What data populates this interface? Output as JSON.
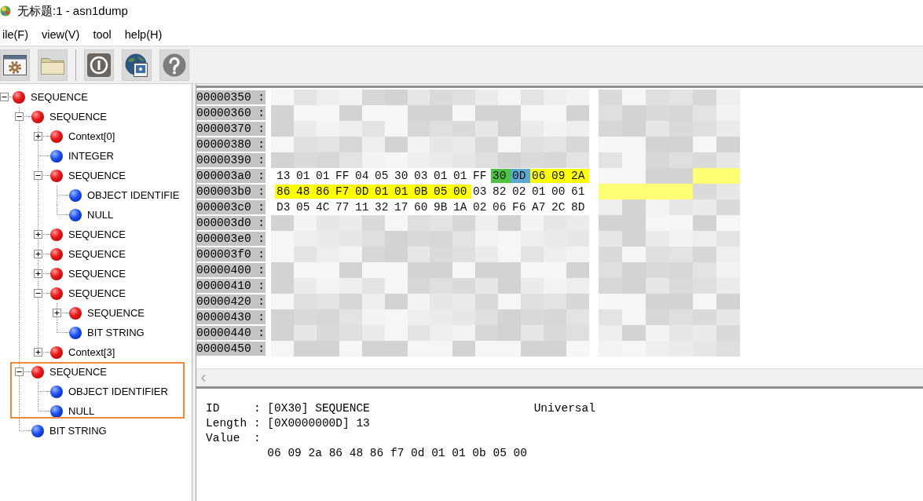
{
  "window": {
    "title": "无标题:1 - asn1dump"
  },
  "menu": [
    "ile(F)",
    "view(V)",
    "tool",
    "help(H)"
  ],
  "toolbar": [
    {
      "kind": "window-gear"
    },
    {
      "kind": "folder"
    },
    {
      "kind": "separator"
    },
    {
      "kind": "ring-bar"
    },
    {
      "kind": "globe-picture"
    },
    {
      "kind": "help"
    }
  ],
  "tree": [
    {
      "label": "SEQUENCE",
      "kind": "constructed",
      "expanded": true,
      "annotated": false,
      "children": [
        {
          "label": "SEQUENCE",
          "kind": "constructed",
          "expanded": true,
          "annotated": false,
          "children": [
            {
              "label": "Context[0]",
              "kind": "constructed",
              "expanded": false,
              "annotated": false
            },
            {
              "label": "INTEGER",
              "kind": "primitive",
              "annotated": false
            },
            {
              "label": "SEQUENCE",
              "kind": "constructed",
              "expanded": true,
              "annotated": false,
              "children": [
                {
                  "label": "OBJECT IDENTIFIE",
                  "kind": "primitive",
                  "annotated": false
                },
                {
                  "label": "NULL",
                  "kind": "primitive",
                  "annotated": false
                }
              ]
            },
            {
              "label": "SEQUENCE",
              "kind": "constructed",
              "expanded": false,
              "annotated": false
            },
            {
              "label": "SEQUENCE",
              "kind": "constructed",
              "expanded": false,
              "annotated": false
            },
            {
              "label": "SEQUENCE",
              "kind": "constructed",
              "expanded": false,
              "annotated": false
            },
            {
              "label": "SEQUENCE",
              "kind": "constructed",
              "expanded": true,
              "annotated": false,
              "children": [
                {
                  "label": "SEQUENCE",
                  "kind": "constructed",
                  "expanded": false,
                  "annotated": false
                },
                {
                  "label": "BIT STRING",
                  "kind": "primitive",
                  "annotated": false
                }
              ]
            },
            {
              "label": "Context[3]",
              "kind": "constructed",
              "expanded": false,
              "annotated": false
            }
          ]
        },
        {
          "label": "SEQUENCE",
          "kind": "constructed",
          "expanded": true,
          "annotated": true,
          "children": [
            {
              "label": "OBJECT IDENTIFIER",
              "kind": "primitive",
              "annotated": false
            },
            {
              "label": "NULL",
              "kind": "primitive",
              "annotated": false
            }
          ]
        },
        {
          "label": "BIT STRING",
          "kind": "primitive",
          "annotated": false
        }
      ]
    }
  ],
  "hex_view": {
    "rows": [
      {
        "offset": "00000350 :",
        "pixelated": true
      },
      {
        "offset": "00000360 :",
        "pixelated": true
      },
      {
        "offset": "00000370 :",
        "pixelated": true
      },
      {
        "offset": "00000380 :",
        "pixelated": true
      },
      {
        "offset": "00000390 :",
        "pixelated": true
      },
      {
        "offset": "000003a0 :",
        "pixelated": false,
        "bytes": [
          {
            "text": "13"
          },
          {
            "text": "01"
          },
          {
            "text": "01"
          },
          {
            "text": "FF"
          },
          {
            "text": "04"
          },
          {
            "text": "05"
          },
          {
            "text": "30"
          },
          {
            "text": "03"
          },
          {
            "text": "01"
          },
          {
            "text": "01"
          },
          {
            "text": "FF"
          },
          {
            "text": "30",
            "color": "#4dc441"
          },
          {
            "text": "0D",
            "color": "#5ba9d3"
          },
          {
            "text": "06",
            "color": "#ffff00"
          },
          {
            "text": "09",
            "color": "#ffff00"
          },
          {
            "text": "2A",
            "color": "#ffff00"
          }
        ]
      },
      {
        "offset": "000003b0 :",
        "pixelated": false,
        "bytes": [
          {
            "text": "86",
            "color": "#ffff00"
          },
          {
            "text": "48",
            "color": "#ffff00"
          },
          {
            "text": "86",
            "color": "#ffff00"
          },
          {
            "text": "F7",
            "color": "#ffff00"
          },
          {
            "text": "0D",
            "color": "#ffff00"
          },
          {
            "text": "01",
            "color": "#ffff00"
          },
          {
            "text": "01",
            "color": "#ffff00"
          },
          {
            "text": "0B",
            "color": "#ffff00"
          },
          {
            "text": "05",
            "color": "#ffff00"
          },
          {
            "text": "00",
            "color": "#ffff00"
          },
          {
            "text": "03"
          },
          {
            "text": "82"
          },
          {
            "text": "02"
          },
          {
            "text": "01"
          },
          {
            "text": "00"
          },
          {
            "text": "61"
          }
        ]
      },
      {
        "offset": "000003c0 :",
        "pixelated": false,
        "bytes": [
          {
            "text": "D3"
          },
          {
            "text": "05"
          },
          {
            "text": "4C"
          },
          {
            "text": "77"
          },
          {
            "text": "11"
          },
          {
            "text": "32"
          },
          {
            "text": "17"
          },
          {
            "text": "60"
          },
          {
            "text": "9B"
          },
          {
            "text": "1A"
          },
          {
            "text": "02"
          },
          {
            "text": "06"
          },
          {
            "text": "F6"
          },
          {
            "text": "A7"
          },
          {
            "text": "2C"
          },
          {
            "text": "8D"
          }
        ]
      },
      {
        "offset": "000003d0 :",
        "pixelated": true
      },
      {
        "offset": "000003e0 :",
        "pixelated": true
      },
      {
        "offset": "000003f0 :",
        "pixelated": true
      },
      {
        "offset": "00000400 :",
        "pixelated": true
      },
      {
        "offset": "00000410 :",
        "pixelated": true
      },
      {
        "offset": "00000420 :",
        "pixelated": true
      },
      {
        "offset": "00000430 :",
        "pixelated": true
      },
      {
        "offset": "00000440 :",
        "pixelated": true
      },
      {
        "offset": "00000450 :",
        "pixelated": true
      }
    ]
  },
  "details": {
    "lines": [
      {
        "label": "ID",
        "separator": ":",
        "value": "[0X30] SEQUENCE",
        "note": "Universal"
      },
      {
        "label": "Length",
        "separator": ":",
        "value": "[0X0000000D] 13"
      },
      {
        "label": "Value",
        "separator": ":"
      }
    ],
    "value_bytes": "06 09 2a 86 48 86 f7 0d 01 01 0b 05 00"
  }
}
